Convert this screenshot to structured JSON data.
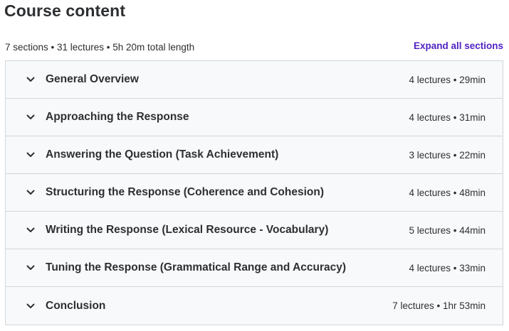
{
  "header": {
    "title": "Course content",
    "summary": "7 sections • 31 lectures • 5h 20m total length",
    "expand_all_label": "Expand all sections"
  },
  "sections": [
    {
      "title": "General Overview",
      "meta": "4 lectures • 29min",
      "icon": "chevron-down-icon"
    },
    {
      "title": "Approaching the Response",
      "meta": "4 lectures • 31min",
      "icon": "chevron-down-icon"
    },
    {
      "title": "Answering the Question (Task Achievement)",
      "meta": "3 lectures • 22min",
      "icon": "chevron-down-icon"
    },
    {
      "title": "Structuring the Response (Coherence and Cohesion)",
      "meta": "4 lectures • 48min",
      "icon": "chevron-down-icon"
    },
    {
      "title": "Writing the Response (Lexical Resource - Vocabulary)",
      "meta": "5 lectures • 44min",
      "icon": "chevron-down-icon"
    },
    {
      "title": "Tuning the Response (Grammatical Range and Accuracy)",
      "meta": "4 lectures • 33min",
      "icon": "chevron-down-icon"
    },
    {
      "title": "Conclusion",
      "meta": "7 lectures • 1hr 53min",
      "icon": "chevron-down-icon"
    }
  ],
  "colors": {
    "text": "#2d2f31",
    "accent": "#5022c3",
    "section_bg": "#f7f9fa",
    "border": "#d1d7dc"
  }
}
